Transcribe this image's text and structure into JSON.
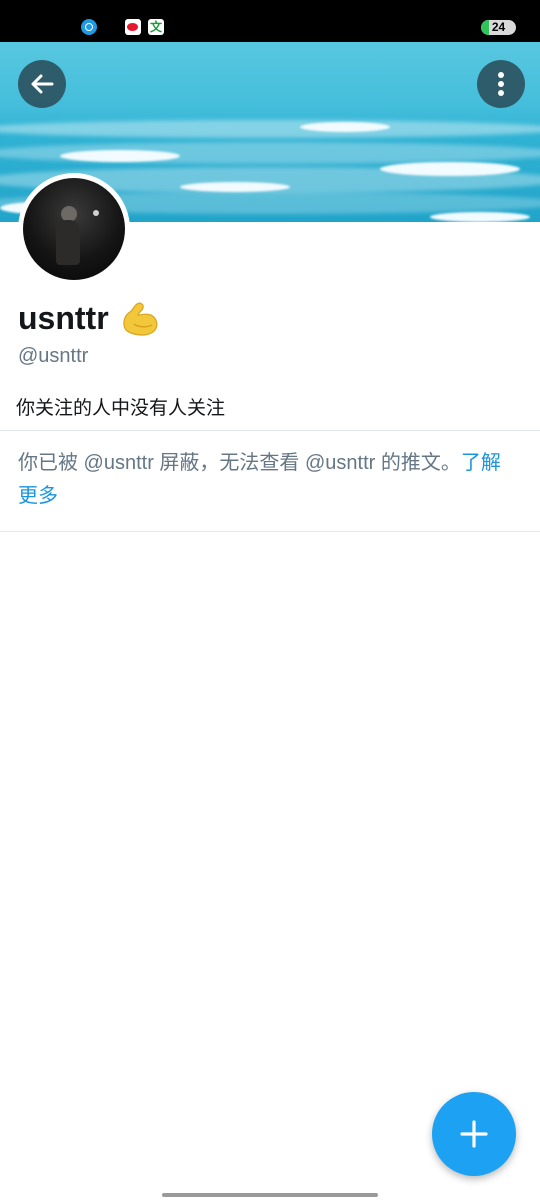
{
  "status_bar": {
    "icons": [
      "app-blue-icon",
      "weibo-icon",
      "wen-icon"
    ],
    "wen_label": "文",
    "battery_level": 24,
    "battery_text": "24",
    "battery_color": "#31c45b"
  },
  "header": {
    "back_icon": "arrow-left-icon",
    "more_icon": "more-vertical-icon",
    "banner": "ocean-waves"
  },
  "profile": {
    "display_name": "usnttr",
    "emoji": "💪",
    "handle": "@usnttr",
    "followers_note": "你关注的人中没有人关注"
  },
  "blocked": {
    "message": "你已被 @usnttr 屏蔽，无法查看 @usnttr 的推文。",
    "link_text": "了解更多",
    "link_color": "#1b95e0"
  },
  "fab": {
    "icon": "plus-icon",
    "color": "#1da1f2"
  }
}
